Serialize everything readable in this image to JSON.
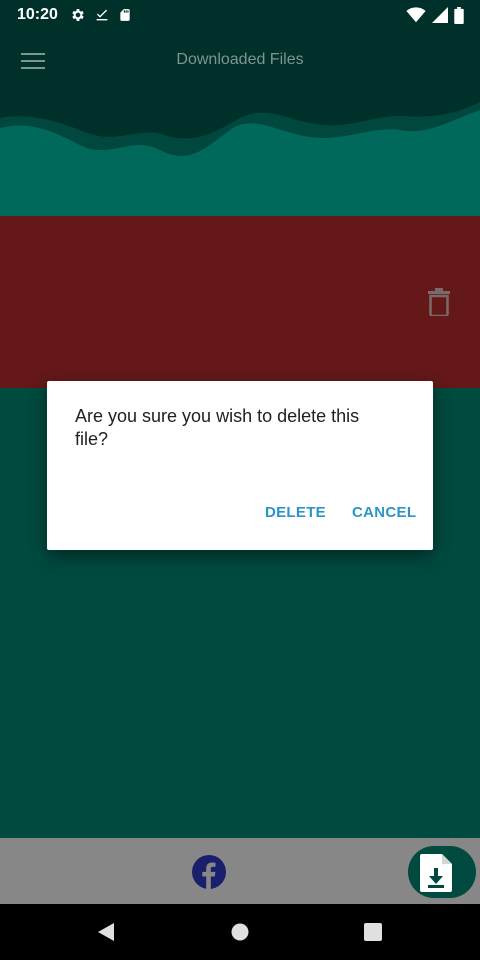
{
  "status_bar": {
    "time": "10:20",
    "left_icons": [
      "gear-icon",
      "download-done-icon",
      "sd-card-icon"
    ],
    "right_icons": [
      "wifi-icon",
      "signal-icon",
      "battery-icon"
    ]
  },
  "app_bar": {
    "title": "Downloaded Files",
    "menu_icon": "hamburger-menu-icon"
  },
  "swipe_row": {
    "background_color": "#641818",
    "action_icon": "trash-icon"
  },
  "dialog": {
    "message": "Are you sure you wish to delete this file?",
    "delete_label": "DELETE",
    "cancel_label": "CANCEL",
    "button_color": "#2b95c8"
  },
  "bottom_bar": {
    "facebook_icon": "facebook-icon",
    "download_icon": "file-download-icon"
  },
  "nav_bar": {
    "icons": [
      "back-icon",
      "home-icon",
      "recents-icon"
    ]
  },
  "colors": {
    "primary_dark": "#00302a",
    "primary": "#00695c",
    "content_bg": "#004a3f",
    "bottom_bar": "#878787"
  }
}
